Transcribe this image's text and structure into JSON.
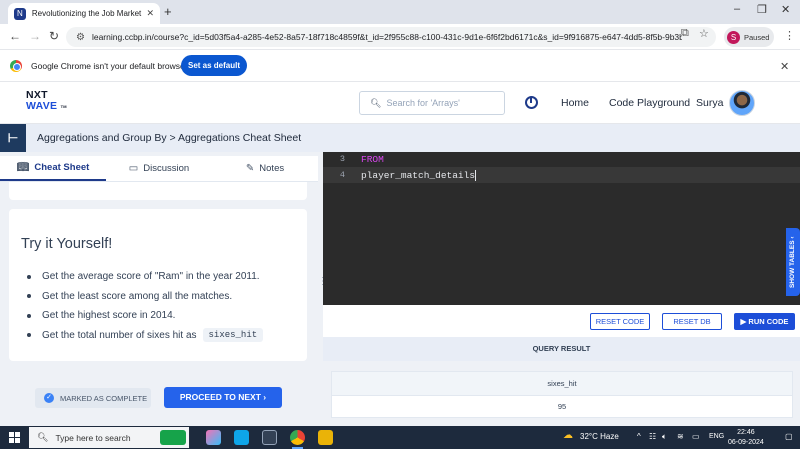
{
  "browser": {
    "tab_title": "Revolutionizing the Job Market",
    "url": "learning.ccbp.in/course?c_id=5d03f5a4-a285-4e52-8a57-18f718c4859f&t_id=2f955c88-c100-431c-9d1e-6f6f2bd6171c&s_id=9f916875-e647-4dd5-8f5b-9b3b0...",
    "profile_initial": "S",
    "profile_status": "Paused",
    "infobar_text": "Google Chrome isn't your default browser",
    "set_default_label": "Set as default"
  },
  "header": {
    "logo_line1": "NXT",
    "logo_line2": "WAVE",
    "logo_tm": "TM",
    "search_placeholder": "Search for 'Arrays'",
    "nav_home": "Home",
    "nav_playground": "Code Playground",
    "user_name": "Surya"
  },
  "breadcrumb": "Aggregations and Group By > Aggregations Cheat Sheet",
  "left_tabs": [
    {
      "label": "Cheat Sheet"
    },
    {
      "label": "Discussion"
    },
    {
      "label": "Notes"
    }
  ],
  "try_it": {
    "title": "Try it Yourself!",
    "items": [
      "Get the average score of \"Ram\" in the year 2011.",
      "Get the least score among all the matches.",
      "Get the highest score in 2014.",
      "Get the total number of sixes hit as"
    ],
    "code_chip": "sixes_hit"
  },
  "actions": {
    "marked_complete": "MARKED AS COMPLETE",
    "proceed": "PROCEED TO NEXT"
  },
  "editor": {
    "lines": [
      {
        "num": "3",
        "text": "FROM"
      },
      {
        "num": "4",
        "text": "player_match_details"
      }
    ],
    "reset_code": "RESET CODE",
    "reset_db": "RESET DB",
    "run_code": "RUN CODE",
    "show_tables": "SHOW TABLES"
  },
  "result": {
    "heading": "QUERY RESULT",
    "column": "sixes_hit",
    "value": "95"
  },
  "taskbar": {
    "search_placeholder": "Type here to search",
    "weather": "32°C  Haze",
    "language": "ENG",
    "time": "22:46",
    "date": "06-09-2024"
  },
  "colors": {
    "accent": "#2563eb",
    "sidebar_dark": "#1e3a5f",
    "editor_bg": "#2b2b2b",
    "keyword": "#d946ef"
  }
}
